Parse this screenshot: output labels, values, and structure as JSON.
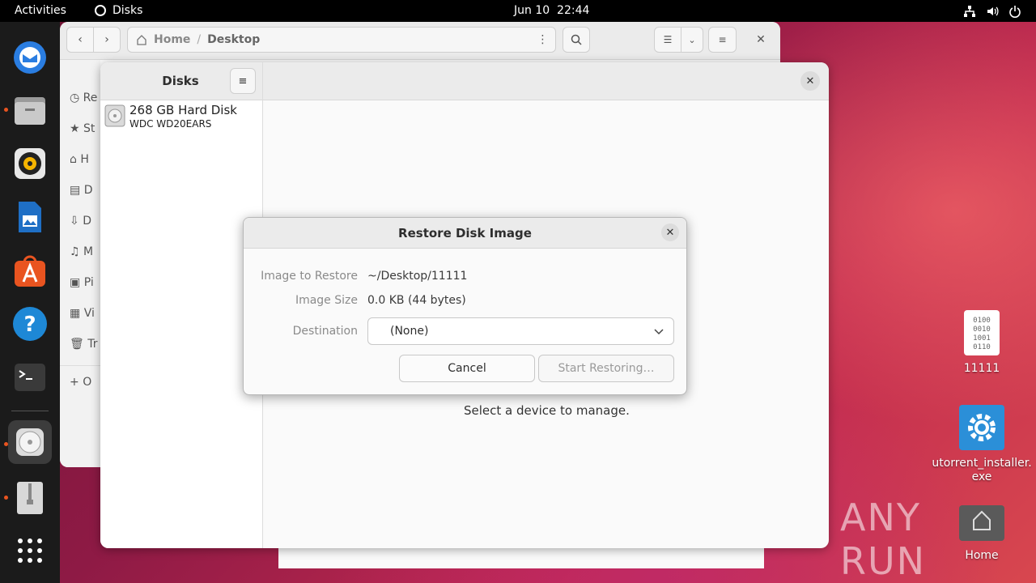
{
  "topbar": {
    "activities": "Activities",
    "app_name": "Disks",
    "date": "Jun 10",
    "time": "22:44"
  },
  "dock": {
    "items": [
      {
        "name": "thunderbird-icon"
      },
      {
        "name": "files-icon"
      },
      {
        "name": "rhythmbox-icon"
      },
      {
        "name": "writer-icon"
      },
      {
        "name": "app-center-icon"
      },
      {
        "name": "help-icon"
      },
      {
        "name": "terminal-icon"
      },
      {
        "name": "disks-icon"
      },
      {
        "name": "archive-icon"
      },
      {
        "name": "show-apps-icon"
      }
    ]
  },
  "files_window": {
    "breadcrumb_home": "Home",
    "breadcrumb_sep": "/",
    "breadcrumb_current": "Desktop",
    "sidebar_initials": [
      "Re",
      "St",
      "H",
      "D",
      "D",
      "M",
      "Pi",
      "Vi",
      "Tr",
      "O"
    ]
  },
  "disks_window": {
    "title": "Disks",
    "drive_name": "268 GB Hard Disk",
    "drive_model": "WDC WD20EARS",
    "empty_message": "Select a device to manage."
  },
  "dialog": {
    "title": "Restore Disk Image",
    "image_label": "Image to Restore",
    "image_value": "~/Desktop/11111",
    "size_label": "Image Size",
    "size_value": "0.0 KB (44 bytes)",
    "dest_label": "Destination",
    "dest_value": "(None)",
    "cancel": "Cancel",
    "start": "Start Restoring…"
  },
  "desktop_icons": [
    {
      "label": "11111"
    },
    {
      "label_line1": "utorrent_installer.",
      "label_line2": "exe"
    },
    {
      "label": "Home"
    }
  ],
  "watermark": "ANY RUN"
}
